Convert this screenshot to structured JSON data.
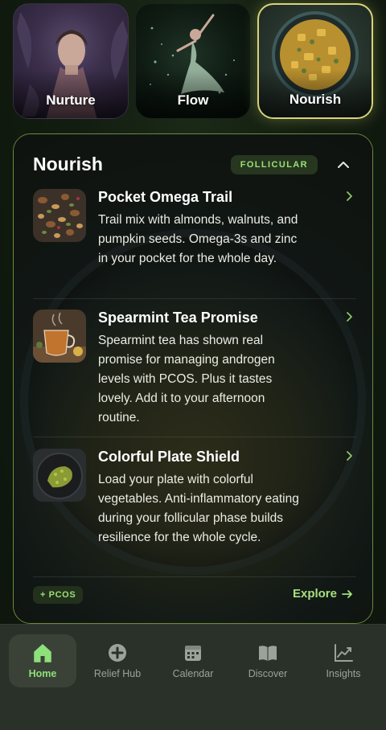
{
  "tiles": [
    {
      "label": "Nurture",
      "selected": false,
      "image": "woman-meditating-with-ferns"
    },
    {
      "label": "Flow",
      "selected": false,
      "image": "dancer-with-sparkles"
    },
    {
      "label": "Nourish",
      "selected": true,
      "image": "bowl-of-stew"
    }
  ],
  "card": {
    "title": "Nourish",
    "phase_badge": "FOLLICULAR",
    "items": [
      {
        "title": "Pocket Omega Trail",
        "description": "Trail mix with almonds, walnuts, and pumpkin seeds. Omega-3s and zinc in your pocket for the whole day.",
        "thumbnail": "trail-mix-nuts"
      },
      {
        "title": "Spearmint Tea Promise",
        "description": "Spearmint tea has shown real promise for managing androgen levels with PCOS. Plus it tastes lovely. Add it to your afternoon routine.",
        "thumbnail": "cup-of-tea"
      },
      {
        "title": "Colorful Plate Shield",
        "description": "Load your plate with colorful vegetables. Anti-inflammatory eating during your follicular phase builds resilience for the whole cycle.",
        "thumbnail": "plate-of-greens"
      }
    ],
    "tag": "+ PCOS",
    "explore_label": "Explore"
  },
  "nav": {
    "items": [
      {
        "label": "Home",
        "icon": "home-icon",
        "active": true
      },
      {
        "label": "Relief Hub",
        "icon": "plus-circle-icon",
        "active": false
      },
      {
        "label": "Calendar",
        "icon": "calendar-icon",
        "active": false
      },
      {
        "label": "Discover",
        "icon": "book-icon",
        "active": false
      },
      {
        "label": "Insights",
        "icon": "chart-icon",
        "active": false
      }
    ]
  },
  "colors": {
    "accent_green": "#9be07a",
    "selected_tile_border": "#d9d27a",
    "card_border": "#6e8a3c",
    "nav_background": "#2a3128"
  }
}
